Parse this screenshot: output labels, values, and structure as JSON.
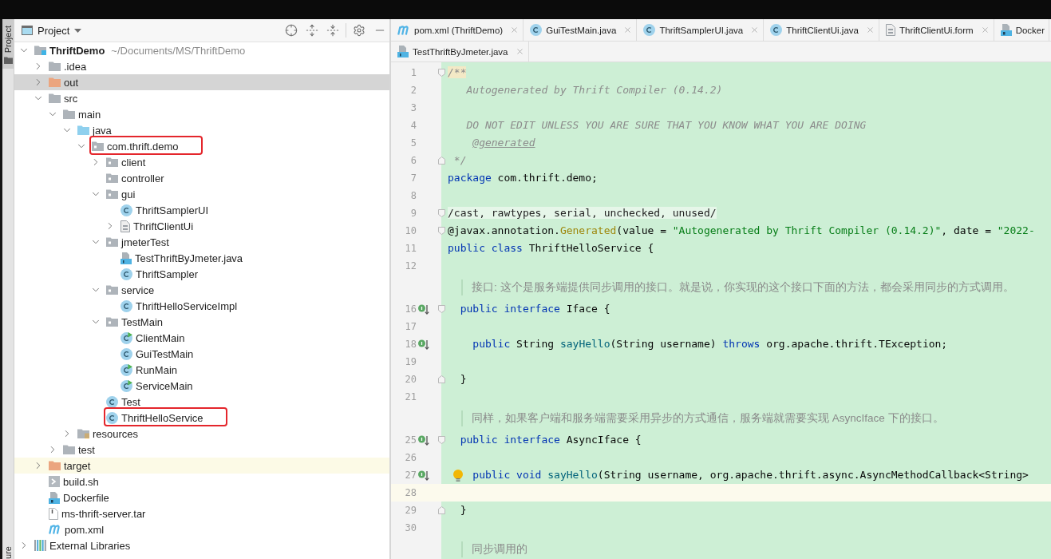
{
  "side_stripe": {
    "top_tabs": [
      {
        "label": "Project",
        "selected": true
      }
    ],
    "bottom_tabs": [
      {
        "label": "ure",
        "selected": false
      }
    ]
  },
  "project_panel": {
    "title": "Project",
    "tree": [
      {
        "label": "ThriftDemo",
        "detail": "~/Documents/MS/ThriftDemo",
        "kind": "project",
        "expanded": true,
        "selected": false,
        "highlighted": false,
        "marked": false,
        "children": [
          {
            "label": ".idea",
            "kind": "folder",
            "expanded": false,
            "selected": false,
            "highlighted": false,
            "marked": false
          },
          {
            "label": "out",
            "kind": "excluded-folder",
            "expanded": false,
            "selected": true,
            "highlighted": false,
            "marked": false
          },
          {
            "label": "src",
            "kind": "folder",
            "expanded": true,
            "selected": false,
            "highlighted": false,
            "marked": false,
            "children": [
              {
                "label": "main",
                "kind": "folder",
                "expanded": true,
                "selected": false,
                "highlighted": false,
                "marked": false,
                "children": [
                  {
                    "label": "java",
                    "kind": "source-folder",
                    "expanded": true,
                    "selected": false,
                    "highlighted": false,
                    "marked": false,
                    "children": [
                      {
                        "label": "com.thrift.demo",
                        "kind": "package",
                        "expanded": true,
                        "selected": false,
                        "highlighted": false,
                        "marked": true,
                        "children": [
                          {
                            "label": "client",
                            "kind": "package",
                            "expanded": false,
                            "selected": false,
                            "highlighted": false,
                            "marked": false
                          },
                          {
                            "label": "controller",
                            "kind": "package",
                            "selected": false,
                            "highlighted": false,
                            "marked": false
                          },
                          {
                            "label": "gui",
                            "kind": "package",
                            "expanded": true,
                            "selected": false,
                            "highlighted": false,
                            "marked": false,
                            "children": [
                              {
                                "label": "ThriftSamplerUI",
                                "kind": "class",
                                "selected": false,
                                "highlighted": false,
                                "marked": false
                              },
                              {
                                "label": "ThriftClientUi",
                                "kind": "form",
                                "expanded": false,
                                "selected": false,
                                "highlighted": false,
                                "marked": false
                              }
                            ]
                          },
                          {
                            "label": "jmeterTest",
                            "kind": "package",
                            "expanded": true,
                            "selected": false,
                            "highlighted": false,
                            "marked": false,
                            "children": [
                              {
                                "label": "TestThriftByJmeter.java",
                                "kind": "java-file",
                                "selected": false,
                                "highlighted": false,
                                "marked": false
                              },
                              {
                                "label": "ThriftSampler",
                                "kind": "class",
                                "selected": false,
                                "highlighted": false,
                                "marked": false
                              }
                            ]
                          },
                          {
                            "label": "service",
                            "kind": "package",
                            "expanded": true,
                            "selected": false,
                            "highlighted": false,
                            "marked": false,
                            "children": [
                              {
                                "label": "ThriftHelloServiceImpl",
                                "kind": "class",
                                "selected": false,
                                "highlighted": false,
                                "marked": false
                              }
                            ]
                          },
                          {
                            "label": "TestMain",
                            "kind": "package",
                            "expanded": true,
                            "selected": false,
                            "highlighted": false,
                            "marked": false,
                            "children": [
                              {
                                "label": "ClientMain",
                                "kind": "runnable-class",
                                "selected": false,
                                "highlighted": false,
                                "marked": false
                              },
                              {
                                "label": "GuiTestMain",
                                "kind": "class",
                                "selected": false,
                                "highlighted": false,
                                "marked": false
                              },
                              {
                                "label": "RunMain",
                                "kind": "runnable-class",
                                "selected": false,
                                "highlighted": false,
                                "marked": false
                              },
                              {
                                "label": "ServiceMain",
                                "kind": "runnable-class",
                                "selected": false,
                                "highlighted": false,
                                "marked": false
                              }
                            ]
                          },
                          {
                            "label": "Test",
                            "kind": "class",
                            "selected": false,
                            "highlighted": false,
                            "marked": false
                          },
                          {
                            "label": "ThriftHelloService",
                            "kind": "class",
                            "selected": false,
                            "highlighted": false,
                            "marked": true
                          }
                        ]
                      }
                    ]
                  },
                  {
                    "label": "resources",
                    "kind": "resources-folder",
                    "expanded": false,
                    "selected": false,
                    "highlighted": false,
                    "marked": false
                  }
                ]
              },
              {
                "label": "test",
                "kind": "folder",
                "expanded": false,
                "selected": false,
                "highlighted": false,
                "marked": false
              }
            ]
          },
          {
            "label": "target",
            "kind": "excluded-folder",
            "expanded": false,
            "selected": false,
            "highlighted": true,
            "marked": false
          },
          {
            "label": "build.sh",
            "kind": "shell-script",
            "selected": false,
            "highlighted": false,
            "marked": false
          },
          {
            "label": "Dockerfile",
            "kind": "docker-file",
            "selected": false,
            "highlighted": false,
            "marked": false
          },
          {
            "label": "ms-thrift-server.tar",
            "kind": "archive",
            "selected": false,
            "highlighted": false,
            "marked": false
          },
          {
            "label": "pom.xml",
            "kind": "maven",
            "selected": false,
            "highlighted": false,
            "marked": false
          }
        ]
      },
      {
        "label": "External Libraries",
        "kind": "libraries",
        "expanded": false,
        "selected": false,
        "highlighted": false,
        "marked": false
      }
    ]
  },
  "editor": {
    "tab_rows": [
      [
        {
          "label": "pom.xml (ThriftDemo)",
          "kind": "maven",
          "selected": false,
          "closable": true
        },
        {
          "label": "GuiTestMain.java",
          "kind": "class",
          "selected": false,
          "closable": true
        },
        {
          "label": "ThriftSamplerUI.java",
          "kind": "class",
          "selected": false,
          "closable": true
        },
        {
          "label": "ThriftClientUi.java",
          "kind": "class",
          "selected": false,
          "closable": true
        },
        {
          "label": "ThriftClientUi.form",
          "kind": "form",
          "selected": false,
          "closable": true
        },
        {
          "label": "Docker",
          "kind": "docker-file",
          "selected": false,
          "closable": false
        }
      ],
      [
        {
          "label": "TestThriftByJmeter.java",
          "kind": "java-file",
          "selected": false,
          "closable": true
        }
      ]
    ],
    "lines": [
      {
        "kind": "code",
        "number": "1",
        "current": false,
        "marks": [
          {
            "kind": "fold-start"
          }
        ],
        "tokens": [
          {
            "text": "/**",
            "kind": "match"
          }
        ]
      },
      {
        "kind": "code",
        "number": "2",
        "current": false,
        "tokens": [
          {
            "text": "   Autogenerated by Thrift Compiler (0.14.2)",
            "kind": "comment"
          }
        ]
      },
      {
        "kind": "code",
        "number": "3",
        "current": false
      },
      {
        "kind": "code",
        "number": "4",
        "current": false,
        "tokens": [
          {
            "text": "   DO NOT EDIT UNLESS YOU ARE SURE THAT YOU KNOW WHAT YOU ARE DOING",
            "kind": "comment"
          }
        ]
      },
      {
        "kind": "code",
        "number": "5",
        "current": false,
        "tokens": [
          {
            "text": "    @generated",
            "kind": "doc-tag"
          }
        ]
      },
      {
        "kind": "code",
        "number": "6",
        "current": false,
        "marks": [
          {
            "kind": "fold-end"
          }
        ],
        "tokens": [
          {
            "text": " */",
            "kind": "comment"
          }
        ]
      },
      {
        "kind": "code",
        "number": "7",
        "current": false,
        "tokens": [
          {
            "text": "package",
            "kind": "keyword"
          },
          {
            "text": " com.thrift.demo;",
            "kind": "plain"
          }
        ]
      },
      {
        "kind": "code",
        "number": "8",
        "current": false
      },
      {
        "kind": "code",
        "number": "9",
        "current": false,
        "marks": [
          {
            "kind": "fold-start"
          }
        ],
        "tokens": [
          {
            "text": "/cast, rawtypes, serial, unchecked, unused/",
            "kind": "folded"
          }
        ]
      },
      {
        "kind": "code",
        "number": "10",
        "current": false,
        "marks": [
          {
            "kind": "fold-start"
          }
        ],
        "tokens": [
          {
            "text": "@javax.annotation.",
            "kind": "plain"
          },
          {
            "text": "Generated",
            "kind": "annotation"
          },
          {
            "text": "(value = ",
            "kind": "plain"
          },
          {
            "text": "\"Autogenerated by Thrift Compiler (0.14.2)\"",
            "kind": "string"
          },
          {
            "text": ", date = ",
            "kind": "plain"
          },
          {
            "text": "\"2022-",
            "kind": "string"
          }
        ]
      },
      {
        "kind": "code",
        "number": "11",
        "current": false,
        "tokens": [
          {
            "text": "public class",
            "kind": "keyword"
          },
          {
            "text": " ThriftHelloService {",
            "kind": "plain"
          }
        ]
      },
      {
        "kind": "code",
        "number": "12",
        "current": false
      },
      {
        "kind": "doc",
        "text": "接口: 这个是服务端提供同步调用的接口。就是说，你实现的这个接口下面的方法，都会采用同步的方式调用。"
      },
      {
        "kind": "code",
        "number": "16",
        "current": false,
        "marks": [
          {
            "kind": "implemented"
          },
          {
            "kind": "fold-start"
          }
        ],
        "tokens": [
          {
            "text": "  public interface",
            "kind": "keyword"
          },
          {
            "text": " Iface {",
            "kind": "plain"
          }
        ]
      },
      {
        "kind": "code",
        "number": "17",
        "current": false
      },
      {
        "kind": "code",
        "number": "18",
        "current": false,
        "marks": [
          {
            "kind": "implemented"
          }
        ],
        "tokens": [
          {
            "text": "    public",
            "kind": "keyword"
          },
          {
            "text": " String ",
            "kind": "plain"
          },
          {
            "text": "sayHello",
            "kind": "method"
          },
          {
            "text": "(String username) ",
            "kind": "plain"
          },
          {
            "text": "throws",
            "kind": "keyword"
          },
          {
            "text": " org.apache.thrift.TException;",
            "kind": "plain"
          }
        ]
      },
      {
        "kind": "code",
        "number": "19",
        "current": false
      },
      {
        "kind": "code",
        "number": "20",
        "current": false,
        "marks": [
          {
            "kind": "fold-end"
          }
        ],
        "tokens": [
          {
            "text": "  }",
            "kind": "plain"
          }
        ]
      },
      {
        "kind": "code",
        "number": "21",
        "current": false
      },
      {
        "kind": "doc",
        "text": "同样，如果客户端和服务端需要采用异步的方式通信，服务端就需要实现 AsyncIface 下的接口。"
      },
      {
        "kind": "code",
        "number": "25",
        "current": false,
        "marks": [
          {
            "kind": "implemented"
          },
          {
            "kind": "fold-start"
          }
        ],
        "tokens": [
          {
            "text": "  public interface",
            "kind": "keyword"
          },
          {
            "text": " AsyncIface {",
            "kind": "plain"
          }
        ]
      },
      {
        "kind": "code",
        "number": "26",
        "current": false
      },
      {
        "kind": "code",
        "number": "27",
        "current": false,
        "marks": [
          {
            "kind": "implemented"
          },
          {
            "kind": "bulb"
          }
        ],
        "tokens": [
          {
            "text": "    public void",
            "kind": "keyword"
          },
          {
            "text": " sayHello",
            "kind": "method"
          },
          {
            "text": "(String username, org.apache.thrift.async.AsyncMethodCallback<String>",
            "kind": "plain"
          }
        ]
      },
      {
        "kind": "code",
        "number": "28",
        "current": true
      },
      {
        "kind": "code",
        "number": "29",
        "current": false,
        "marks": [
          {
            "kind": "fold-end"
          }
        ],
        "tokens": [
          {
            "text": "  }",
            "kind": "plain"
          }
        ]
      },
      {
        "kind": "code",
        "number": "30",
        "current": false
      },
      {
        "kind": "doc",
        "text": "同步调用的"
      }
    ]
  }
}
